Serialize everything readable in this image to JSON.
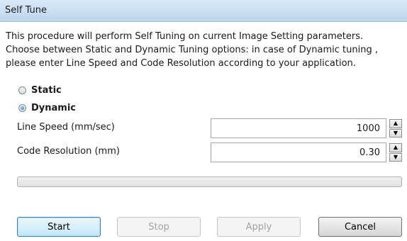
{
  "window": {
    "title": "Self Tune"
  },
  "description": [
    "This procedure will perform Self Tuning on current Image Setting parameters.",
    "Choose between Static and Dynamic Tuning options: in case of Dynamic tuning ,",
    "please enter Line Speed and Code Resolution according to your application."
  ],
  "mode": {
    "options": [
      {
        "label": "Static",
        "checked": false
      },
      {
        "label": "Dynamic",
        "checked": true
      }
    ]
  },
  "fields": {
    "line_speed": {
      "label": "Line Speed (mm/sec)",
      "value": "1000"
    },
    "code_resolution": {
      "label": "Code Resolution (mm)",
      "value": "0.30"
    }
  },
  "progress": {
    "value_percent": 0
  },
  "buttons": {
    "start": "Start",
    "stop": "Stop",
    "apply": "Apply",
    "cancel": "Cancel"
  },
  "icons": {
    "spin_up": "up-arrow-icon",
    "spin_down": "down-arrow-icon"
  },
  "colors": {
    "title_bar": "#c9ddf2",
    "default_button_border": "#3c7fb1",
    "disabled_text": "#a2a2a2"
  }
}
